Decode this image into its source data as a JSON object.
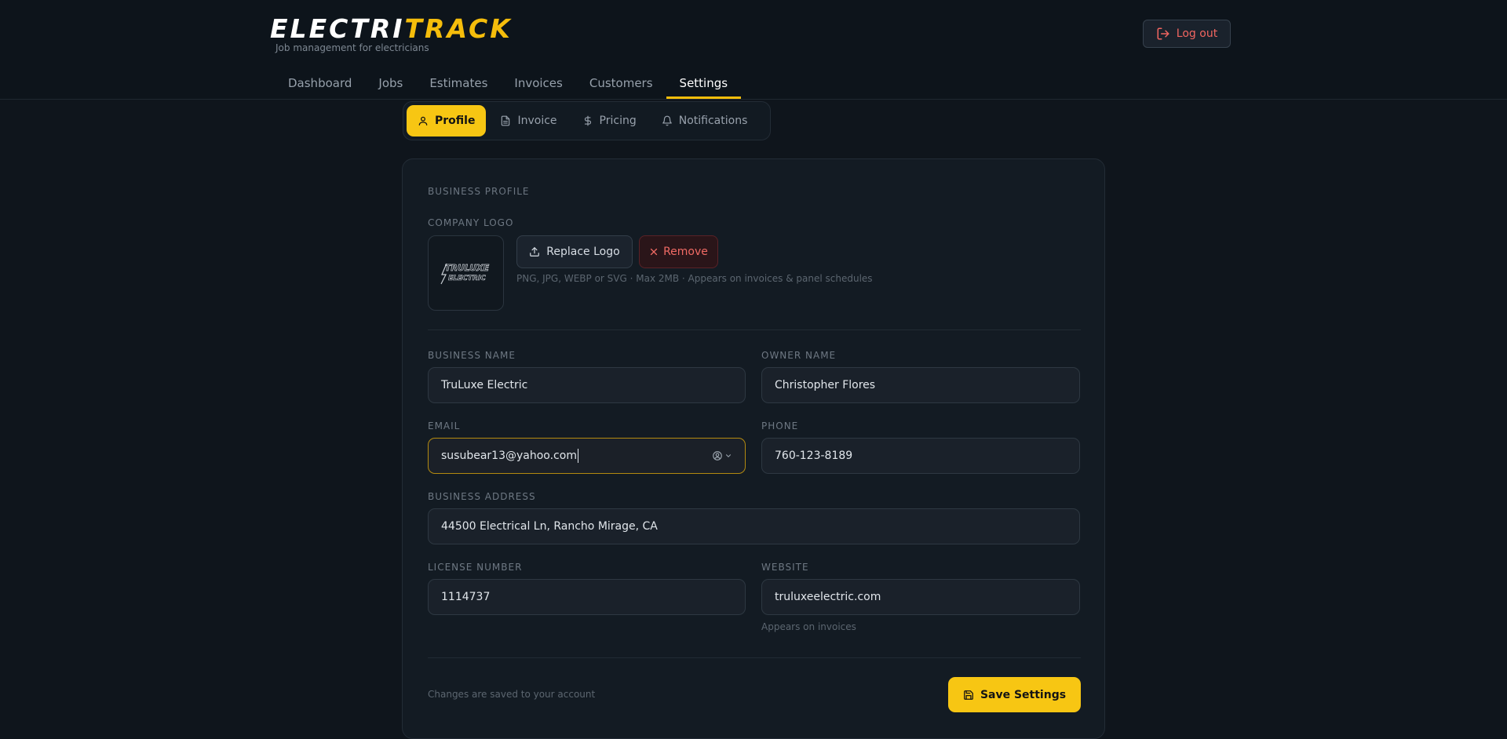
{
  "app": {
    "logo_part1": "ELECTRI",
    "logo_part2": "TRACK",
    "tagline": "Job management for electricians",
    "logout_label": "Log out"
  },
  "nav": {
    "items": [
      {
        "label": "Dashboard"
      },
      {
        "label": "Jobs"
      },
      {
        "label": "Estimates"
      },
      {
        "label": "Invoices"
      },
      {
        "label": "Customers"
      },
      {
        "label": "Settings",
        "active": true
      }
    ]
  },
  "subtabs": [
    {
      "label": "Profile",
      "icon": "user-icon",
      "active": true
    },
    {
      "label": "Invoice",
      "icon": "document-icon"
    },
    {
      "label": "Pricing",
      "icon": "dollar-icon"
    },
    {
      "label": "Notifications",
      "icon": "bell-icon"
    }
  ],
  "profile": {
    "section_title": "BUSINESS PROFILE",
    "logo_label": "COMPANY LOGO",
    "logo_text_1": "TRULUXE",
    "logo_text_2": "ELECTRIC",
    "replace_label": "Replace Logo",
    "remove_label": "Remove",
    "logo_hint": "PNG, JPG, WEBP or SVG · Max 2MB · Appears on invoices & panel schedules",
    "fields": {
      "business_name": {
        "label": "BUSINESS NAME",
        "value": "TruLuxe Electric"
      },
      "owner_name": {
        "label": "OWNER NAME",
        "value": "Christopher Flores"
      },
      "email": {
        "label": "EMAIL",
        "value": "susubear13@yahoo.com"
      },
      "phone": {
        "label": "PHONE",
        "value": "760-123-8189"
      },
      "address": {
        "label": "BUSINESS ADDRESS",
        "value": "44500 Electrical Ln, Rancho Mirage, CA"
      },
      "license": {
        "label": "LICENSE NUMBER",
        "value": "1114737"
      },
      "website": {
        "label": "WEBSITE",
        "value": "truluxeelectric.com",
        "hint": "Appears on invoices"
      }
    },
    "footnote": "Changes are saved to your account",
    "save_label": "Save Settings"
  },
  "colors": {
    "accent": "#f7c613",
    "danger": "#f06a64",
    "background": "#0f151c"
  }
}
